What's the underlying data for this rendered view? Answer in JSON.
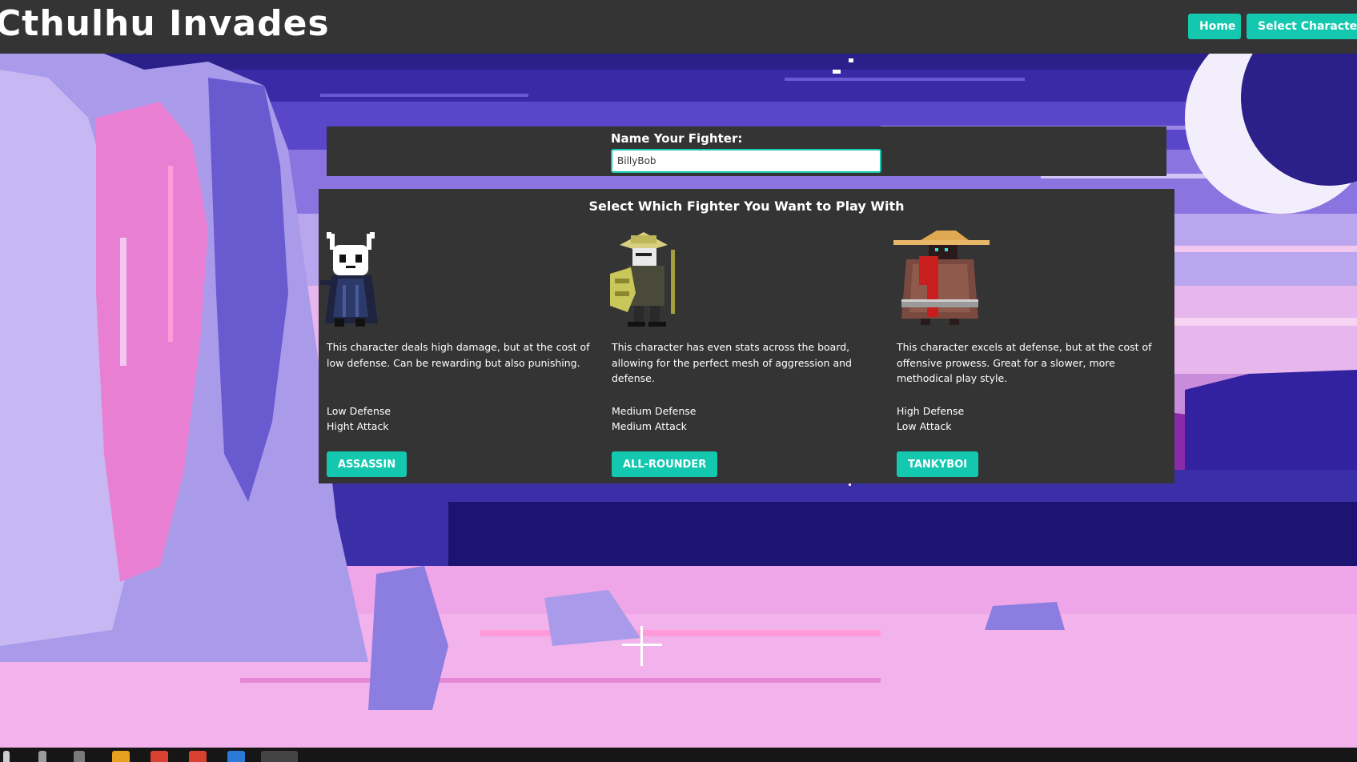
{
  "app": {
    "title": "Cthulhu Invades"
  },
  "nav": {
    "home_label": "Home",
    "select_label": "Select Character"
  },
  "name_form": {
    "label": "Name Your Fighter:",
    "value": "BillyBob"
  },
  "fighters": {
    "title": "Select Which Fighter You Want to Play With",
    "items": [
      {
        "description": "This character deals high damage, but at the cost of low defense. Can be rewarding but also punishing.",
        "defense": "Low Defense",
        "attack": "Hight Attack",
        "button": "ASSASSIN",
        "icon": "horned-knight-sprite-icon"
      },
      {
        "description": "This character has even stats across the board, allowing for the perfect mesh of aggression and defense.",
        "defense": "Medium Defense",
        "attack": "Medium Attack",
        "button": "ALL-ROUNDER",
        "icon": "straw-hat-warrior-sprite-icon"
      },
      {
        "description": "This character excels at defense, but at the cost of offensive prowess. Great for a slower, more methodical play style.",
        "defense": "High Defense",
        "attack": "Low Attack",
        "button": "TANKYBOI",
        "icon": "cloaked-wanderer-sprite-icon"
      }
    ]
  },
  "colors": {
    "navbar": "#343434",
    "accent": "#14c8b0",
    "panel": "#343434",
    "text": "#ffffff"
  }
}
